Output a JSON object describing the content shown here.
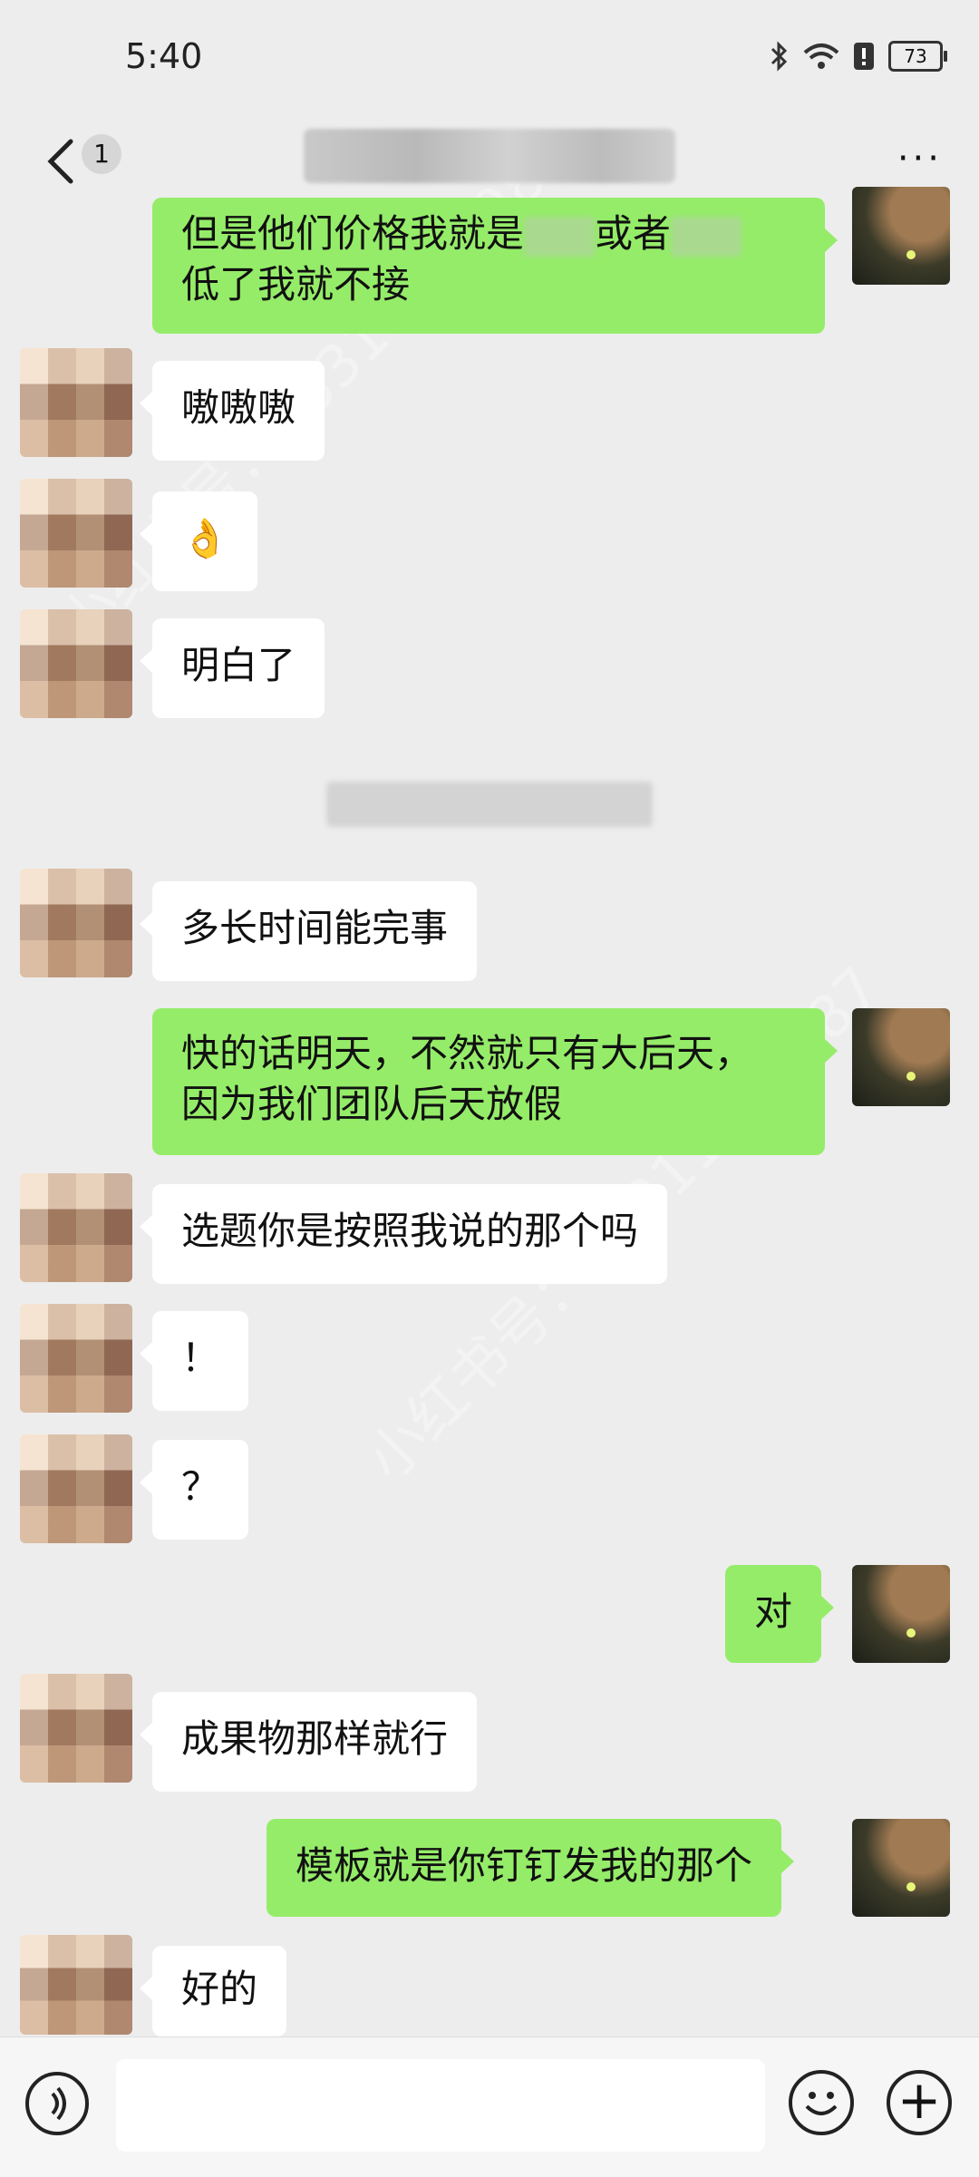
{
  "status_bar": {
    "time": "5:40",
    "battery": "73"
  },
  "header": {
    "unread_count": "1",
    "more": "···"
  },
  "messages": [
    {
      "side": "out",
      "line1_a": "但是他们价格我就是",
      "line1_b": "或者",
      "line2": "低了我就不接"
    },
    {
      "side": "in",
      "text": "嗷嗷嗷"
    },
    {
      "side": "in",
      "text": "👌"
    },
    {
      "side": "in",
      "text": "明白了"
    },
    {
      "side": "in",
      "text": "多长时间能完事"
    },
    {
      "side": "out",
      "line1": "快的话明天，不然就只有大后天，",
      "line2": "因为我们团队后天放假"
    },
    {
      "side": "in",
      "text": "选题你是按照我说的那个吗"
    },
    {
      "side": "in",
      "text": "！"
    },
    {
      "side": "in",
      "text": "？"
    },
    {
      "side": "out",
      "text": "对"
    },
    {
      "side": "in",
      "text": "成果物那样就行"
    },
    {
      "side": "out",
      "text": "模板就是你钉钉发我的那个"
    },
    {
      "side": "in",
      "text": "好的"
    }
  ],
  "watermark": "小红书号：95311484987",
  "icons": {
    "back": "chevron-left-icon",
    "more": "more-icon",
    "voice": "voice-icon",
    "emoji": "emoji-icon",
    "plus": "plus-icon"
  }
}
